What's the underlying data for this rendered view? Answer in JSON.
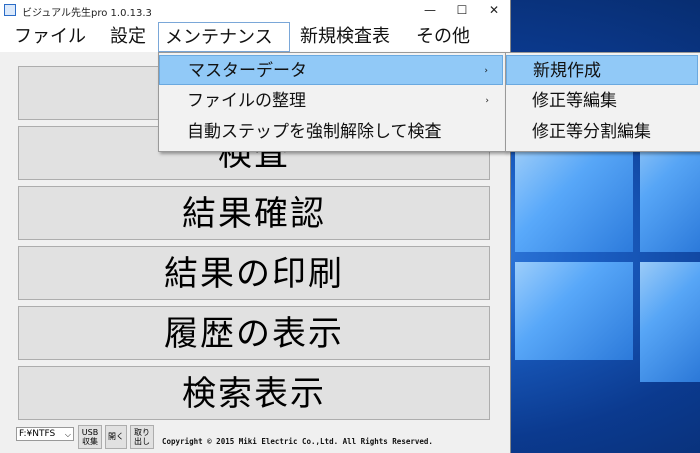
{
  "window": {
    "title": "ビジュアル先生pro  1.0.13.3",
    "minimize": "—",
    "maximize": "☐",
    "close": "✕"
  },
  "menubar": [
    "ファイル",
    "設定",
    "メンテナンス",
    "新規検査表",
    "その他"
  ],
  "maintenance_menu": {
    "items": [
      {
        "label": "マスターデータ",
        "submenu": true,
        "highlighted": true
      },
      {
        "label": "ファイルの整理",
        "submenu": true,
        "highlighted": false
      },
      {
        "label": "自動ステップを強制解除して検査",
        "submenu": false,
        "highlighted": false
      }
    ],
    "arrow": "›"
  },
  "master_submenu": {
    "items": [
      {
        "label": "新規作成",
        "highlighted": true
      },
      {
        "label": "修正等編集",
        "highlighted": false
      },
      {
        "label": "修正等分割編集",
        "highlighted": false
      }
    ]
  },
  "main_buttons": [
    "",
    "検査",
    "結果確認",
    "結果の印刷",
    "履歴の表示",
    "検索表示"
  ],
  "footer": {
    "drive": "F:¥NTFS",
    "drive_chevron": "⌵",
    "usb_button": "USB\n収集",
    "open_button": "開く",
    "eject_button": "取り\n出し",
    "copyright": "Copyright © 2015 Miki Electric Co.,Ltd. All Rights Reserved."
  },
  "colors": {
    "highlight": "#91c9f7",
    "desktop": "#1b5fc4"
  }
}
